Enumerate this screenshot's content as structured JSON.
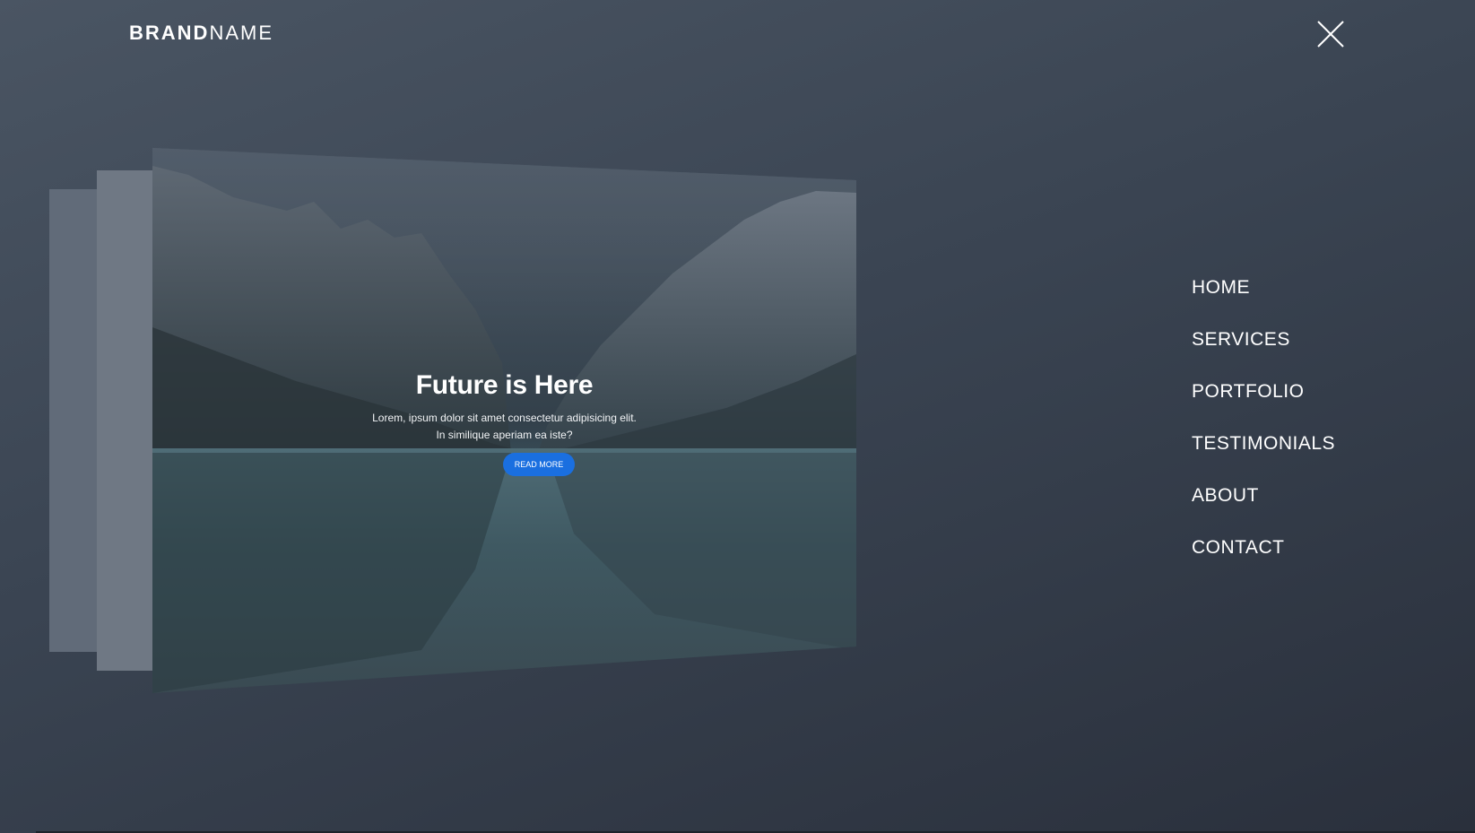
{
  "brand": {
    "bold": "BRAND",
    "light": "NAME"
  },
  "close_button": {
    "icon": "close-icon"
  },
  "hero": {
    "title": "Future is Here",
    "line1": "Lorem, ipsum dolor sit amet consectetur adipisicing elit.",
    "line2": "In similique aperiam ea iste?",
    "button_label": "READ MORE",
    "button_color": "#1a6fe0"
  },
  "nav": {
    "items": [
      {
        "label": "HOME"
      },
      {
        "label": "SERVICES"
      },
      {
        "label": "PORTFOLIO"
      },
      {
        "label": "TESTIMONIALS"
      },
      {
        "label": "ABOUT"
      },
      {
        "label": "CONTACT"
      }
    ]
  },
  "colors": {
    "background": "#3a4452",
    "accent": "#1a6fe0",
    "text": "#ffffff"
  }
}
